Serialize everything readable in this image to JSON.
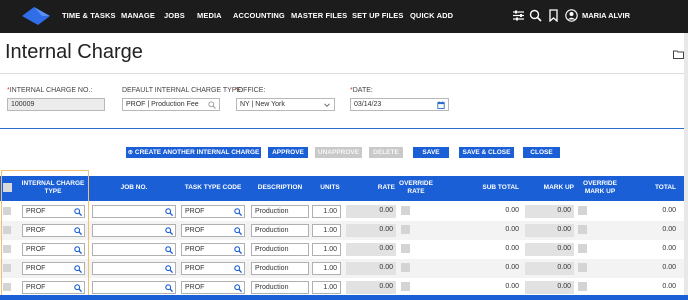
{
  "nav": {
    "items": [
      "TIME & TASKS",
      "MANAGE",
      "JOBS",
      "MEDIA",
      "ACCOUNTING",
      "MASTER FILES",
      "SET UP FILES",
      "QUICK ADD"
    ],
    "user": "MARIA ALVIR"
  },
  "page": {
    "title": "Internal Charge"
  },
  "form": {
    "charge_no_label": "INTERNAL CHARGE NO.:",
    "charge_no_value": "100009",
    "type_label": "DEFAULT INTERNAL CHARGE TYPE:",
    "type_value": "PROF | Production Fee",
    "office_label": "OFFICE:",
    "office_value": "NY | New York",
    "date_label": "DATE:",
    "date_value": "03/14/23"
  },
  "actions": {
    "create": "CREATE ANOTHER INTERNAL CHARGE",
    "approve": "APPROVE",
    "unapprove": "UNAPPROVE",
    "delete": "DELETE",
    "save": "SAVE",
    "save_close": "SAVE & CLOSE",
    "close": "CLOSE"
  },
  "table": {
    "headers": {
      "type_1": "INTERNAL CHARGE",
      "type_2": "TYPE",
      "job": "JOB NO.",
      "task": "TASK TYPE CODE",
      "desc": "DESCRIPTION",
      "units": "UNITS",
      "rate": "RATE",
      "override_1": "OVERRIDE",
      "override_2": "RATE",
      "subtotal": "SUB TOTAL",
      "markup": "MARK UP",
      "override_mu_1": "OVERRIDE",
      "override_mu_2": "MARK UP",
      "total": "TOTAL"
    },
    "rows": [
      {
        "type": "PROF",
        "job": "",
        "task": "PROF",
        "desc": "Production",
        "units": "1.00",
        "rate": "0.00",
        "subtotal": "0.00",
        "markup": "0.00",
        "total": "0.00"
      },
      {
        "type": "PROF",
        "job": "",
        "task": "PROF",
        "desc": "Production",
        "units": "1.00",
        "rate": "0.00",
        "subtotal": "0.00",
        "markup": "0.00",
        "total": "0.00"
      },
      {
        "type": "PROF",
        "job": "",
        "task": "PROF",
        "desc": "Production",
        "units": "1.00",
        "rate": "0.00",
        "subtotal": "0.00",
        "markup": "0.00",
        "total": "0.00"
      },
      {
        "type": "PROF",
        "job": "",
        "task": "PROF",
        "desc": "Production",
        "units": "1.00",
        "rate": "0.00",
        "subtotal": "0.00",
        "markup": "0.00",
        "total": "0.00"
      },
      {
        "type": "PROF",
        "job": "",
        "task": "PROF",
        "desc": "Production",
        "units": "1.00",
        "rate": "0.00",
        "subtotal": "0.00",
        "markup": "0.00",
        "total": "0.00"
      }
    ]
  },
  "colors": {
    "accent": "#1b5fd6",
    "nav_bg": "#1c1c1c",
    "required": "#d9342b"
  }
}
